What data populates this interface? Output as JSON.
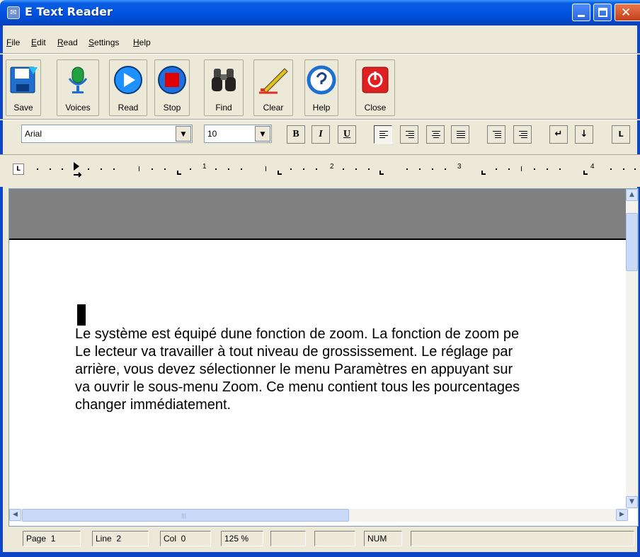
{
  "window": {
    "title": "E Text Reader",
    "icon": "book-icon"
  },
  "menu": [
    {
      "label": "File",
      "u": "F",
      "rest": "ile"
    },
    {
      "label": "Edit",
      "u": "E",
      "rest": "dit"
    },
    {
      "label": "Read",
      "u": "R",
      "rest": "ead"
    },
    {
      "label": "Settings",
      "u": "S",
      "rest": "ettings"
    },
    {
      "label": "Help",
      "u": "H",
      "rest": "elp"
    }
  ],
  "toolbar": {
    "save": "Save",
    "voices": "Voices",
    "read": "Read",
    "stop": "Stop",
    "find": "Find",
    "clear": "Clear",
    "help": "Help",
    "close": "Close"
  },
  "format": {
    "font": "Arial",
    "size": "10",
    "bold": "B",
    "italic": "I",
    "underline": "U"
  },
  "ruler": {
    "numbers": [
      "1",
      "2",
      "3",
      "4"
    ]
  },
  "document": {
    "lines": [
      "Le système est équipé dune fonction de zoom. La fonction de zoom pe",
      "Le lecteur va travailler à tout niveau de grossissement. Le réglage par",
      "arrière, vous devez sélectionner le menu Paramètres en appuyant sur",
      "va ouvrir le sous-menu Zoom. Ce menu contient tous les pourcentages",
      "changer immédiatement."
    ]
  },
  "status": {
    "page": "Page  1",
    "line": "Line  2",
    "col": "Col  0",
    "zoom": "125 %",
    "num": "NUM"
  },
  "colors": {
    "titlebar": "#0054e3",
    "accent_red": "#e00000",
    "accent_blue": "#1e90ff"
  }
}
